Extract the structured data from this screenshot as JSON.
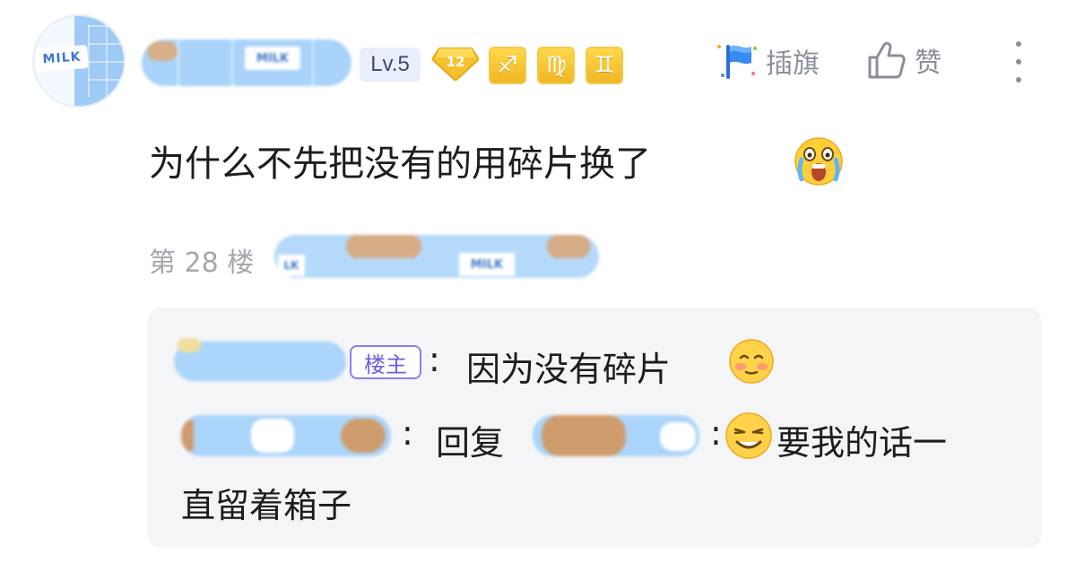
{
  "post": {
    "avatar_text": "MILK",
    "username_sticker_text": "MILK",
    "level": "Lv.5",
    "gem_level": "12",
    "zodiac_badges": [
      "♐",
      "♍",
      "♊"
    ],
    "actions": {
      "flag_label": "插旗",
      "like_label": "赞"
    },
    "comment_text": "为什么不先把没有的用碎片换了",
    "comment_emoji": "scream-crying-emoji",
    "floor": "第 28 楼",
    "floor_tag_stickers": [
      "LK",
      "MILK"
    ]
  },
  "replies": [
    {
      "badge": "楼主",
      "colon": ":",
      "text": "因为没有碎片",
      "emoji": "blush-emoji"
    },
    {
      "colon": ":",
      "reply_word": "回复",
      "colon2": ":",
      "text_part1": "要我的话一",
      "text_part2": "直留着箱子",
      "emoji": "smug-smile-emoji"
    }
  ],
  "colors": {
    "accent_purple": "#6c5fe3",
    "badge_gold": "#f0b623",
    "muted_gray": "#8a8f99",
    "reply_bg": "#f4f5f7"
  }
}
